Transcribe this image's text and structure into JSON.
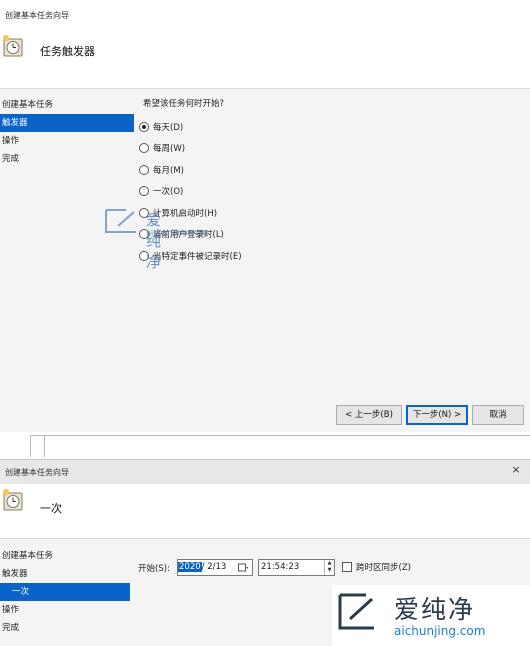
{
  "window1": {
    "title": "创建基本任务向导",
    "header_title": "任务触发器",
    "nav": [
      "创建基本任务",
      "触发器",
      "操作",
      "完成"
    ],
    "question": "希望该任务何时开始?",
    "options": [
      {
        "label": "每天(D)",
        "checked": true
      },
      {
        "label": "每周(W)",
        "checked": false
      },
      {
        "label": "每月(M)",
        "checked": false
      },
      {
        "label": "一次(O)",
        "checked": false
      },
      {
        "label": "计算机启动时(H)",
        "checked": false
      },
      {
        "label": "当前用户登录时(L)",
        "checked": false
      },
      {
        "label": "当特定事件被记录时(E)",
        "checked": false
      }
    ],
    "buttons": {
      "back": "< 上一步(B)",
      "next": "下一步(N) >",
      "cancel": "取消"
    },
    "watermark_brand": "爱纯净",
    "watermark_url": "aichunjing.com"
  },
  "window2": {
    "title": "创建基本任务向导",
    "header_title": "一次",
    "nav": [
      "创建基本任务",
      "触发器",
      "一次",
      "操作",
      "完成"
    ],
    "start_label": "开始(S):",
    "date_year": "2020",
    "date_rest": "/ 2/13",
    "time_value": "21:54:23",
    "sync_label": "跨时区同步(Z)",
    "close_glyph": "×"
  },
  "brand": {
    "name": "爱纯净",
    "url": "aichunjing.com"
  },
  "colors": {
    "selection": "#0a64c8",
    "brand_blue": "#1a7ed9"
  }
}
